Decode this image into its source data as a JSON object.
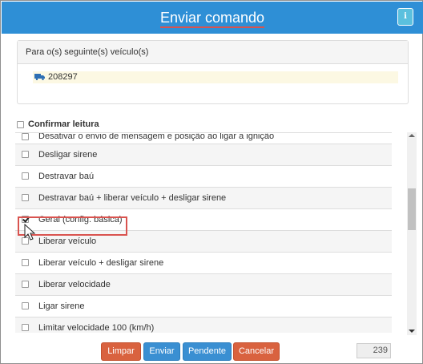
{
  "header": {
    "title": "Enviar comando",
    "info_icon": "i"
  },
  "vehicles": {
    "heading": "Para o(s) seguinte(s) veículo(s)",
    "items": [
      {
        "icon": "truck-icon",
        "id": "208297"
      }
    ]
  },
  "confirm": {
    "label": "Confirmar leitura",
    "checked": false
  },
  "commands": [
    {
      "label": "Desativar o envio de mensagem e posição ao ligar a ignição",
      "checked": false
    },
    {
      "label": "Desligar sirene",
      "checked": false
    },
    {
      "label": "Destravar baú",
      "checked": false
    },
    {
      "label": "Destravar baú + liberar veículo + desligar sirene",
      "checked": false
    },
    {
      "label": "Geral (config. básica)",
      "checked": true
    },
    {
      "label": "Liberar veículo",
      "checked": false
    },
    {
      "label": "Liberar veículo + desligar sirene",
      "checked": false
    },
    {
      "label": "Liberar velocidade",
      "checked": false
    },
    {
      "label": "Ligar sirene",
      "checked": false
    },
    {
      "label": "Limitar velocidade 100 (km/h)",
      "checked": false
    }
  ],
  "footer": {
    "limpar": "Limpar",
    "enviar": "Enviar",
    "pendente": "Pendente",
    "cancelar": "Cancelar",
    "char_count": "239"
  },
  "colors": {
    "header": "#2e8fd6",
    "primary_button": "#3a8fd2",
    "danger_button": "#d9623f",
    "highlight": "#d9534f",
    "vehicle_row": "#fcf8e3"
  }
}
